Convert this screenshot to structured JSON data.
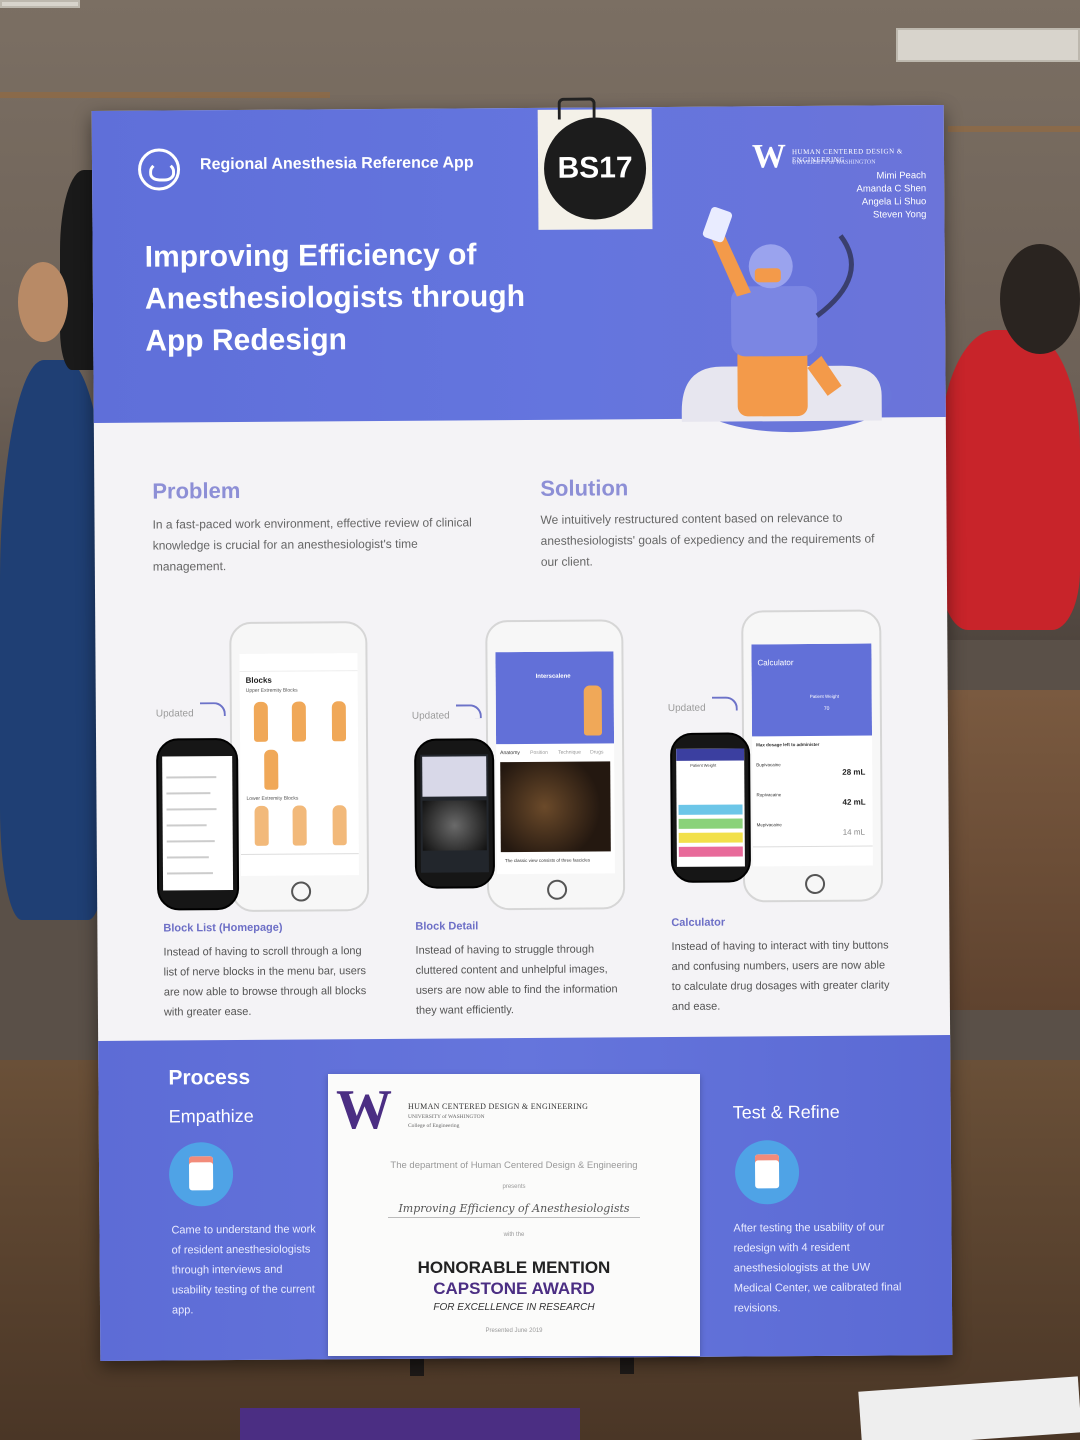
{
  "poster": {
    "app_name": "Regional Anesthesia Reference App",
    "headline_lines": [
      "Improving Efficiency of",
      "Anesthesiologists through",
      "App Redesign"
    ],
    "badge": "BS17",
    "uw": {
      "letter": "W",
      "dept": "HUMAN CENTERED DESIGN & ENGINEERING",
      "univ": "UNIVERSITY of WASHINGTON"
    },
    "authors": [
      "Mimi Peach",
      "Amanda C Shen",
      "Angela Li Shuo",
      "Steven Yong"
    ],
    "problem": {
      "title": "Problem",
      "text": "In a fast-paced work environment, effective review of clinical knowledge is crucial for an anesthesiologist's time management."
    },
    "solution": {
      "title": "Solution",
      "text": "We intuitively restructured content based on relevance to anesthesiologists' goals of expediency and the requirements of our client."
    },
    "updated_label": "Updated",
    "features": [
      {
        "title": "Block List (Homepage)",
        "text": "Instead of having to scroll through a long list of nerve blocks in the menu bar, users are now able to browse through all blocks with greater ease.",
        "screen_title": "Blocks",
        "screen_sub1": "Upper Extremity Blocks",
        "screen_sub2": "Lower Extremity Blocks"
      },
      {
        "title": "Block Detail",
        "text": "Instead of having to struggle through cluttered content and unhelpful images, users are now able to find the information they want efficiently.",
        "screen_title": "Interscalene",
        "screen_tabs": [
          "Anatomy",
          "Position",
          "Technique",
          "Drugs"
        ],
        "screen_caption": "The classic view consists of three fascicles"
      },
      {
        "title": "Calculator",
        "text": "Instead of having to interact with tiny buttons and confusing numbers, users are now able to calculate drug dosages with greater clarity and ease.",
        "screen_title": "Calculator",
        "screen_weight_label": "Patient Weight",
        "screen_weight": "70",
        "screen_max": "Max dosage left to administer",
        "drugs": [
          {
            "name": "Bupivacaine",
            "amount": "28 mL"
          },
          {
            "name": "Ropivacaine",
            "amount": "42 mL"
          },
          {
            "name": "Mepivacaine",
            "amount": "14 mL"
          }
        ],
        "old_weight_label": "Patient Weight"
      }
    ],
    "process": {
      "title": "Process",
      "empathize_title": "Empathize",
      "empathize_text": "Came to understand the work of resident anesthesiologists through interviews and usability testing of the current app.",
      "test_title": "Test & Refine",
      "test_text": "After testing the usability of our redesign with 4 resident anesthesiologists at the UW Medical Center, we calibrated final revisions."
    },
    "certificate": {
      "letter": "W",
      "dept": "HUMAN CENTERED DESIGN & ENGINEERING",
      "univ": "UNIVERSITY of WASHINGTON",
      "college": "College of Engineering",
      "line1": "The department of Human Centered Design & Engineering",
      "presents": "presents",
      "project": "Improving Efficiency of Anesthesiologists",
      "with_the": "with the",
      "honor": "HONORABLE MENTION",
      "award": "CAPSTONE AWARD",
      "excellence": "FOR EXCELLENCE IN RESEARCH",
      "presented": "Presented June 2019"
    }
  }
}
